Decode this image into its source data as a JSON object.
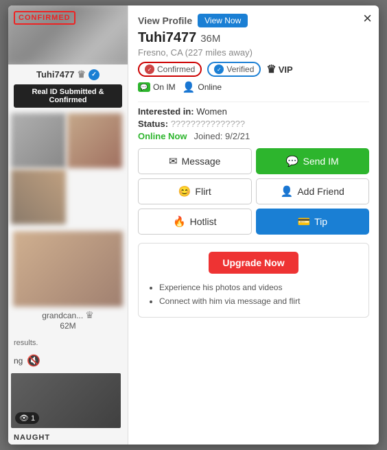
{
  "modal": {
    "close_label": "×"
  },
  "sidebar": {
    "confirmed_label": "CONFIRMED",
    "username": "Tuhi7477",
    "real_id_label": "Real ID Submitted & Confirmed",
    "user2_name": "grandcan...",
    "user2_age": "62M",
    "bottom_text": "results.",
    "notif_text": "ng",
    "naughty_label": "NAUGHT",
    "eye_count": "1"
  },
  "profile": {
    "view_profile_label": "View Profile",
    "view_now_label": "View Now",
    "username": "Tuhi7477",
    "age": "36M",
    "location": "Fresno, CA (227 miles away)",
    "confirmed_label": "Confirmed",
    "verified_label": "Verified",
    "vip_label": "VIP",
    "on_im_label": "On IM",
    "online_label": "Online",
    "interested_label": "Interested in:",
    "interested_value": "Women",
    "status_label": "Status:",
    "status_value": "???????????????",
    "online_now_label": "Online Now",
    "joined_label": "Joined:",
    "joined_date": "9/2/21",
    "buttons": {
      "message": "Message",
      "send_im": "Send IM",
      "flirt": "Flirt",
      "add_friend": "Add Friend",
      "hotlist": "Hotlist",
      "tip": "Tip"
    },
    "upgrade": {
      "button_label": "Upgrade Now",
      "item1": "Experience his photos and videos",
      "item2": "Connect with him via message and flirt"
    }
  }
}
